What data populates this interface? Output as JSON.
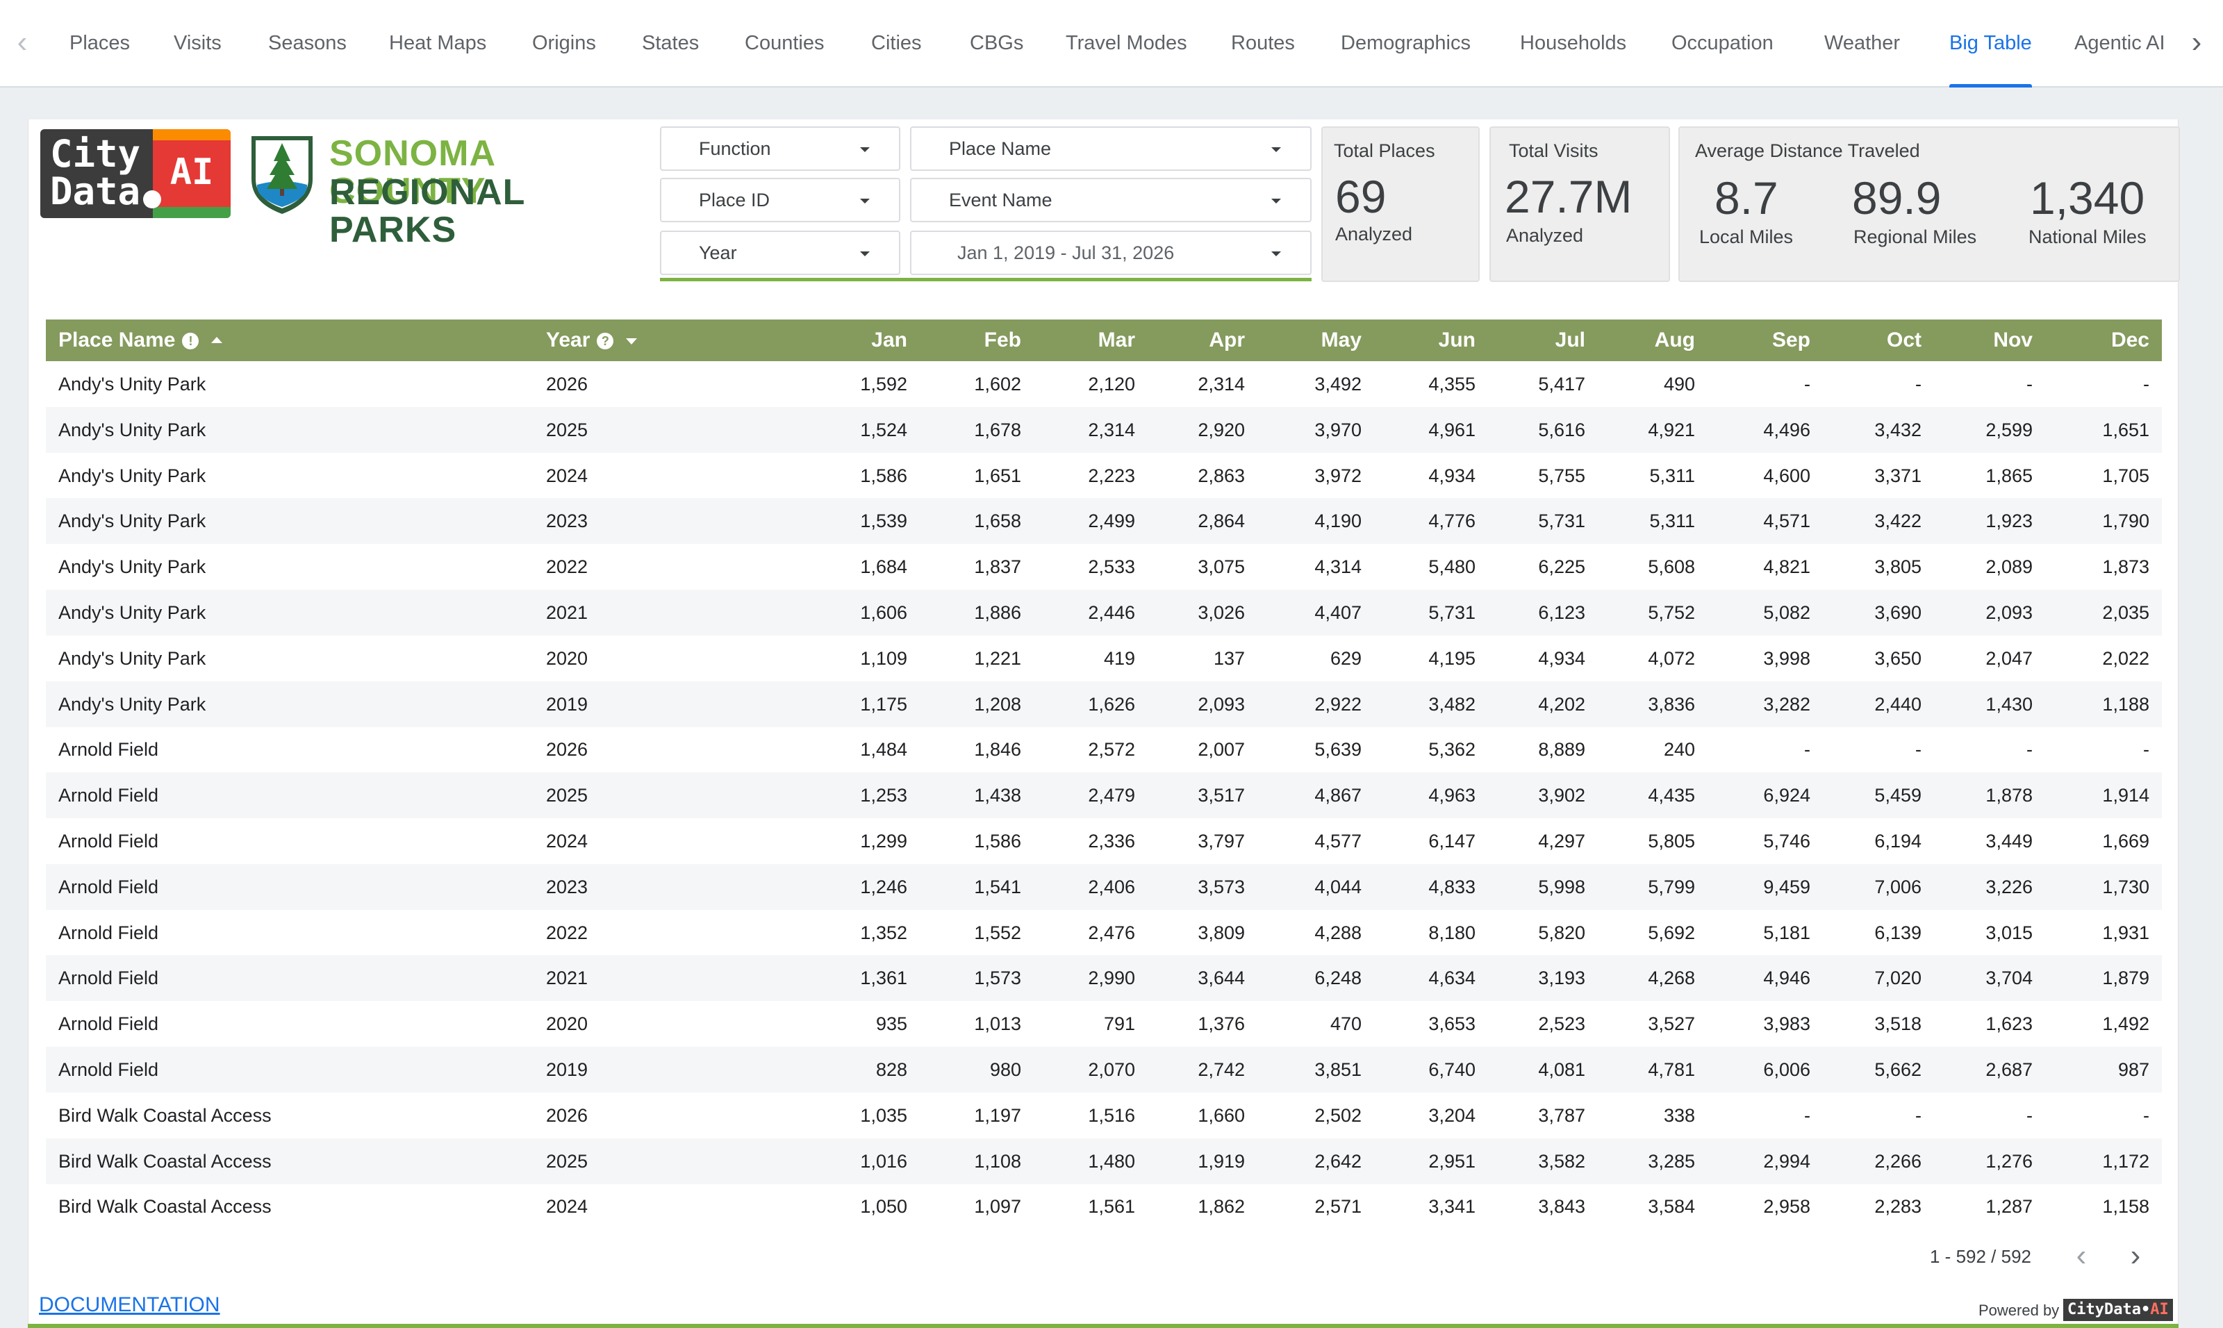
{
  "nav": {
    "tabs": [
      "Places",
      "Visits",
      "Seasons",
      "Heat Maps",
      "Origins",
      "States",
      "Counties",
      "Cities",
      "CBGs",
      "Travel Modes",
      "Routes",
      "Demographics",
      "Households",
      "Occupation",
      "Weather",
      "Big Table",
      "Agentic AI"
    ],
    "active_tab": "Big Table",
    "prev_icon": "‹",
    "next_icon": "›"
  },
  "logo": {
    "citydata_line1": "City",
    "citydata_line2": "Data",
    "citydata_ai": "AI",
    "sonoma_line1": "SONOMA COUNTY",
    "sonoma_line2": "REGIONAL PARKS"
  },
  "filters": {
    "function": "Function",
    "place_id": "Place ID",
    "year": "Year",
    "place_name": "Place Name",
    "event_name": "Event Name",
    "date_range": "Jan 1, 2019 - Jul 31, 2026"
  },
  "stats": {
    "total_places_title": "Total Places",
    "total_places_value": "69",
    "total_places_sub": "Analyzed",
    "total_visits_title": "Total Visits",
    "total_visits_value": "27.7M",
    "total_visits_sub": "Analyzed",
    "distance_title": "Average Distance Traveled",
    "local_value": "8.7",
    "local_label": "Local Miles",
    "regional_value": "89.9",
    "regional_label": "Regional Miles",
    "national_value": "1,340",
    "national_label": "National Miles"
  },
  "table": {
    "headers": {
      "place_name": "Place Name",
      "year": "Year",
      "months": [
        "Jan",
        "Feb",
        "Mar",
        "Apr",
        "May",
        "Jun",
        "Jul",
        "Aug",
        "Sep",
        "Oct",
        "Nov",
        "Dec"
      ]
    },
    "rows": [
      {
        "place": "Andy's Unity Park",
        "year": "2026",
        "m": [
          "1,592",
          "1,602",
          "2,120",
          "2,314",
          "3,492",
          "4,355",
          "5,417",
          "490",
          "-",
          "-",
          "-",
          "-"
        ]
      },
      {
        "place": "Andy's Unity Park",
        "year": "2025",
        "m": [
          "1,524",
          "1,678",
          "2,314",
          "2,920",
          "3,970",
          "4,961",
          "5,616",
          "4,921",
          "4,496",
          "3,432",
          "2,599",
          "1,651"
        ]
      },
      {
        "place": "Andy's Unity Park",
        "year": "2024",
        "m": [
          "1,586",
          "1,651",
          "2,223",
          "2,863",
          "3,972",
          "4,934",
          "5,755",
          "5,311",
          "4,600",
          "3,371",
          "1,865",
          "1,705"
        ]
      },
      {
        "place": "Andy's Unity Park",
        "year": "2023",
        "m": [
          "1,539",
          "1,658",
          "2,499",
          "2,864",
          "4,190",
          "4,776",
          "5,731",
          "5,311",
          "4,571",
          "3,422",
          "1,923",
          "1,790"
        ]
      },
      {
        "place": "Andy's Unity Park",
        "year": "2022",
        "m": [
          "1,684",
          "1,837",
          "2,533",
          "3,075",
          "4,314",
          "5,480",
          "6,225",
          "5,608",
          "4,821",
          "3,805",
          "2,089",
          "1,873"
        ]
      },
      {
        "place": "Andy's Unity Park",
        "year": "2021",
        "m": [
          "1,606",
          "1,886",
          "2,446",
          "3,026",
          "4,407",
          "5,731",
          "6,123",
          "5,752",
          "5,082",
          "3,690",
          "2,093",
          "2,035"
        ]
      },
      {
        "place": "Andy's Unity Park",
        "year": "2020",
        "m": [
          "1,109",
          "1,221",
          "419",
          "137",
          "629",
          "4,195",
          "4,934",
          "4,072",
          "3,998",
          "3,650",
          "2,047",
          "2,022"
        ]
      },
      {
        "place": "Andy's Unity Park",
        "year": "2019",
        "m": [
          "1,175",
          "1,208",
          "1,626",
          "2,093",
          "2,922",
          "3,482",
          "4,202",
          "3,836",
          "3,282",
          "2,440",
          "1,430",
          "1,188"
        ]
      },
      {
        "place": "Arnold Field",
        "year": "2026",
        "m": [
          "1,484",
          "1,846",
          "2,572",
          "2,007",
          "5,639",
          "5,362",
          "8,889",
          "240",
          "-",
          "-",
          "-",
          "-"
        ]
      },
      {
        "place": "Arnold Field",
        "year": "2025",
        "m": [
          "1,253",
          "1,438",
          "2,479",
          "3,517",
          "4,867",
          "4,963",
          "3,902",
          "4,435",
          "6,924",
          "5,459",
          "1,878",
          "1,914"
        ]
      },
      {
        "place": "Arnold Field",
        "year": "2024",
        "m": [
          "1,299",
          "1,586",
          "2,336",
          "3,797",
          "4,577",
          "6,147",
          "4,297",
          "5,805",
          "5,746",
          "6,194",
          "3,449",
          "1,669"
        ]
      },
      {
        "place": "Arnold Field",
        "year": "2023",
        "m": [
          "1,246",
          "1,541",
          "2,406",
          "3,573",
          "4,044",
          "4,833",
          "5,998",
          "5,799",
          "9,459",
          "7,006",
          "3,226",
          "1,730"
        ]
      },
      {
        "place": "Arnold Field",
        "year": "2022",
        "m": [
          "1,352",
          "1,552",
          "2,476",
          "3,809",
          "4,288",
          "8,180",
          "5,820",
          "5,692",
          "5,181",
          "6,139",
          "3,015",
          "1,931"
        ]
      },
      {
        "place": "Arnold Field",
        "year": "2021",
        "m": [
          "1,361",
          "1,573",
          "2,990",
          "3,644",
          "6,248",
          "4,634",
          "3,193",
          "4,268",
          "4,946",
          "7,020",
          "3,704",
          "1,879"
        ]
      },
      {
        "place": "Arnold Field",
        "year": "2020",
        "m": [
          "935",
          "1,013",
          "791",
          "1,376",
          "470",
          "3,653",
          "2,523",
          "3,527",
          "3,983",
          "3,518",
          "1,623",
          "1,492"
        ]
      },
      {
        "place": "Arnold Field",
        "year": "2019",
        "m": [
          "828",
          "980",
          "2,070",
          "2,742",
          "3,851",
          "6,740",
          "4,081",
          "4,781",
          "6,006",
          "5,662",
          "2,687",
          "987"
        ]
      },
      {
        "place": "Bird Walk Coastal Access",
        "year": "2026",
        "m": [
          "1,035",
          "1,197",
          "1,516",
          "1,660",
          "2,502",
          "3,204",
          "3,787",
          "338",
          "-",
          "-",
          "-",
          "-"
        ]
      },
      {
        "place": "Bird Walk Coastal Access",
        "year": "2025",
        "m": [
          "1,016",
          "1,108",
          "1,480",
          "1,919",
          "2,642",
          "2,951",
          "3,582",
          "3,285",
          "2,994",
          "2,266",
          "1,276",
          "1,172"
        ]
      },
      {
        "place": "Bird Walk Coastal Access",
        "year": "2024",
        "m": [
          "1,050",
          "1,097",
          "1,561",
          "1,862",
          "2,571",
          "3,341",
          "3,843",
          "3,584",
          "2,958",
          "2,283",
          "1,287",
          "1,158"
        ]
      }
    ],
    "pagination": "1 - 592 / 592",
    "prev_page": "‹",
    "next_page": "›"
  },
  "footer": {
    "documentation": "DOCUMENTATION",
    "powered_by": "Powered by",
    "brand_left": "CityData",
    "brand_right": "AI"
  },
  "colors": {
    "header_green": "#859a5d",
    "accent_blue": "#1a73e8",
    "green_line": "#7cb342"
  }
}
